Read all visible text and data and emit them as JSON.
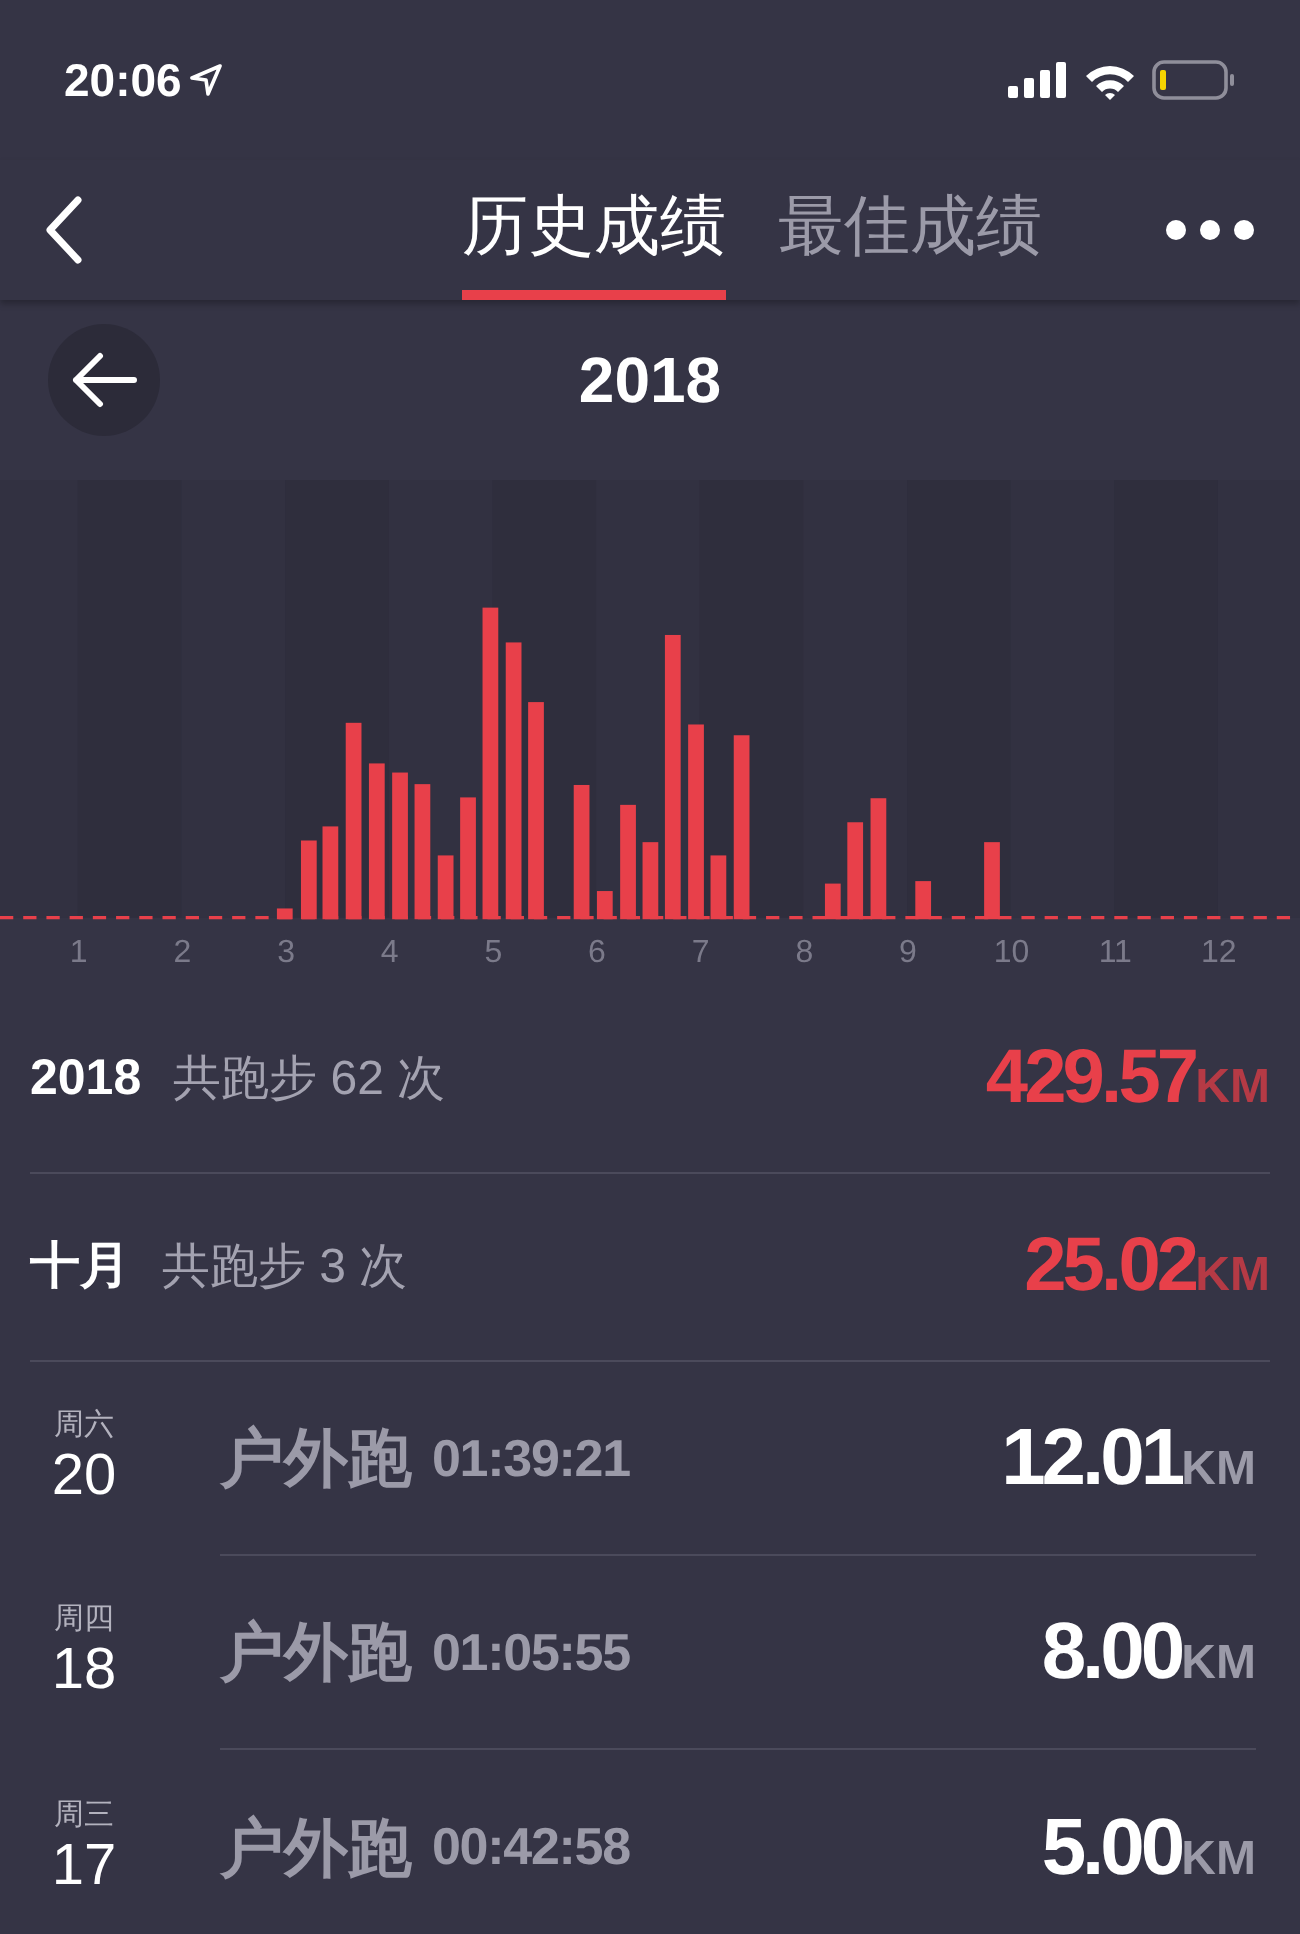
{
  "status_bar": {
    "time": "20:06"
  },
  "nav": {
    "tabs": [
      {
        "label": "历史成绩",
        "selected": true
      },
      {
        "label": "最佳成绩",
        "selected": false
      }
    ]
  },
  "year_header": {
    "title": "2018"
  },
  "chart": {
    "month_labels": [
      "1",
      "2",
      "3",
      "4",
      "5",
      "6",
      "7",
      "8",
      "9",
      "10",
      "11",
      "12"
    ]
  },
  "summaries": [
    {
      "period": "2018",
      "count_text": "共跑步 62 次",
      "distance": "429.57",
      "unit": "KM"
    },
    {
      "period": "十月",
      "count_text": "共跑步 3 次",
      "distance": "25.02",
      "unit": "KM"
    }
  ],
  "records": [
    {
      "weekday": "周六",
      "day": "20",
      "activity": "户外跑",
      "duration": "01:39:21",
      "distance": "12.01",
      "unit": "KM"
    },
    {
      "weekday": "周四",
      "day": "18",
      "activity": "户外跑",
      "duration": "01:05:55",
      "distance": "8.00",
      "unit": "KM"
    },
    {
      "weekday": "周三",
      "day": "17",
      "activity": "户外跑",
      "duration": "00:42:58",
      "distance": "5.00",
      "unit": "KM"
    }
  ]
}
